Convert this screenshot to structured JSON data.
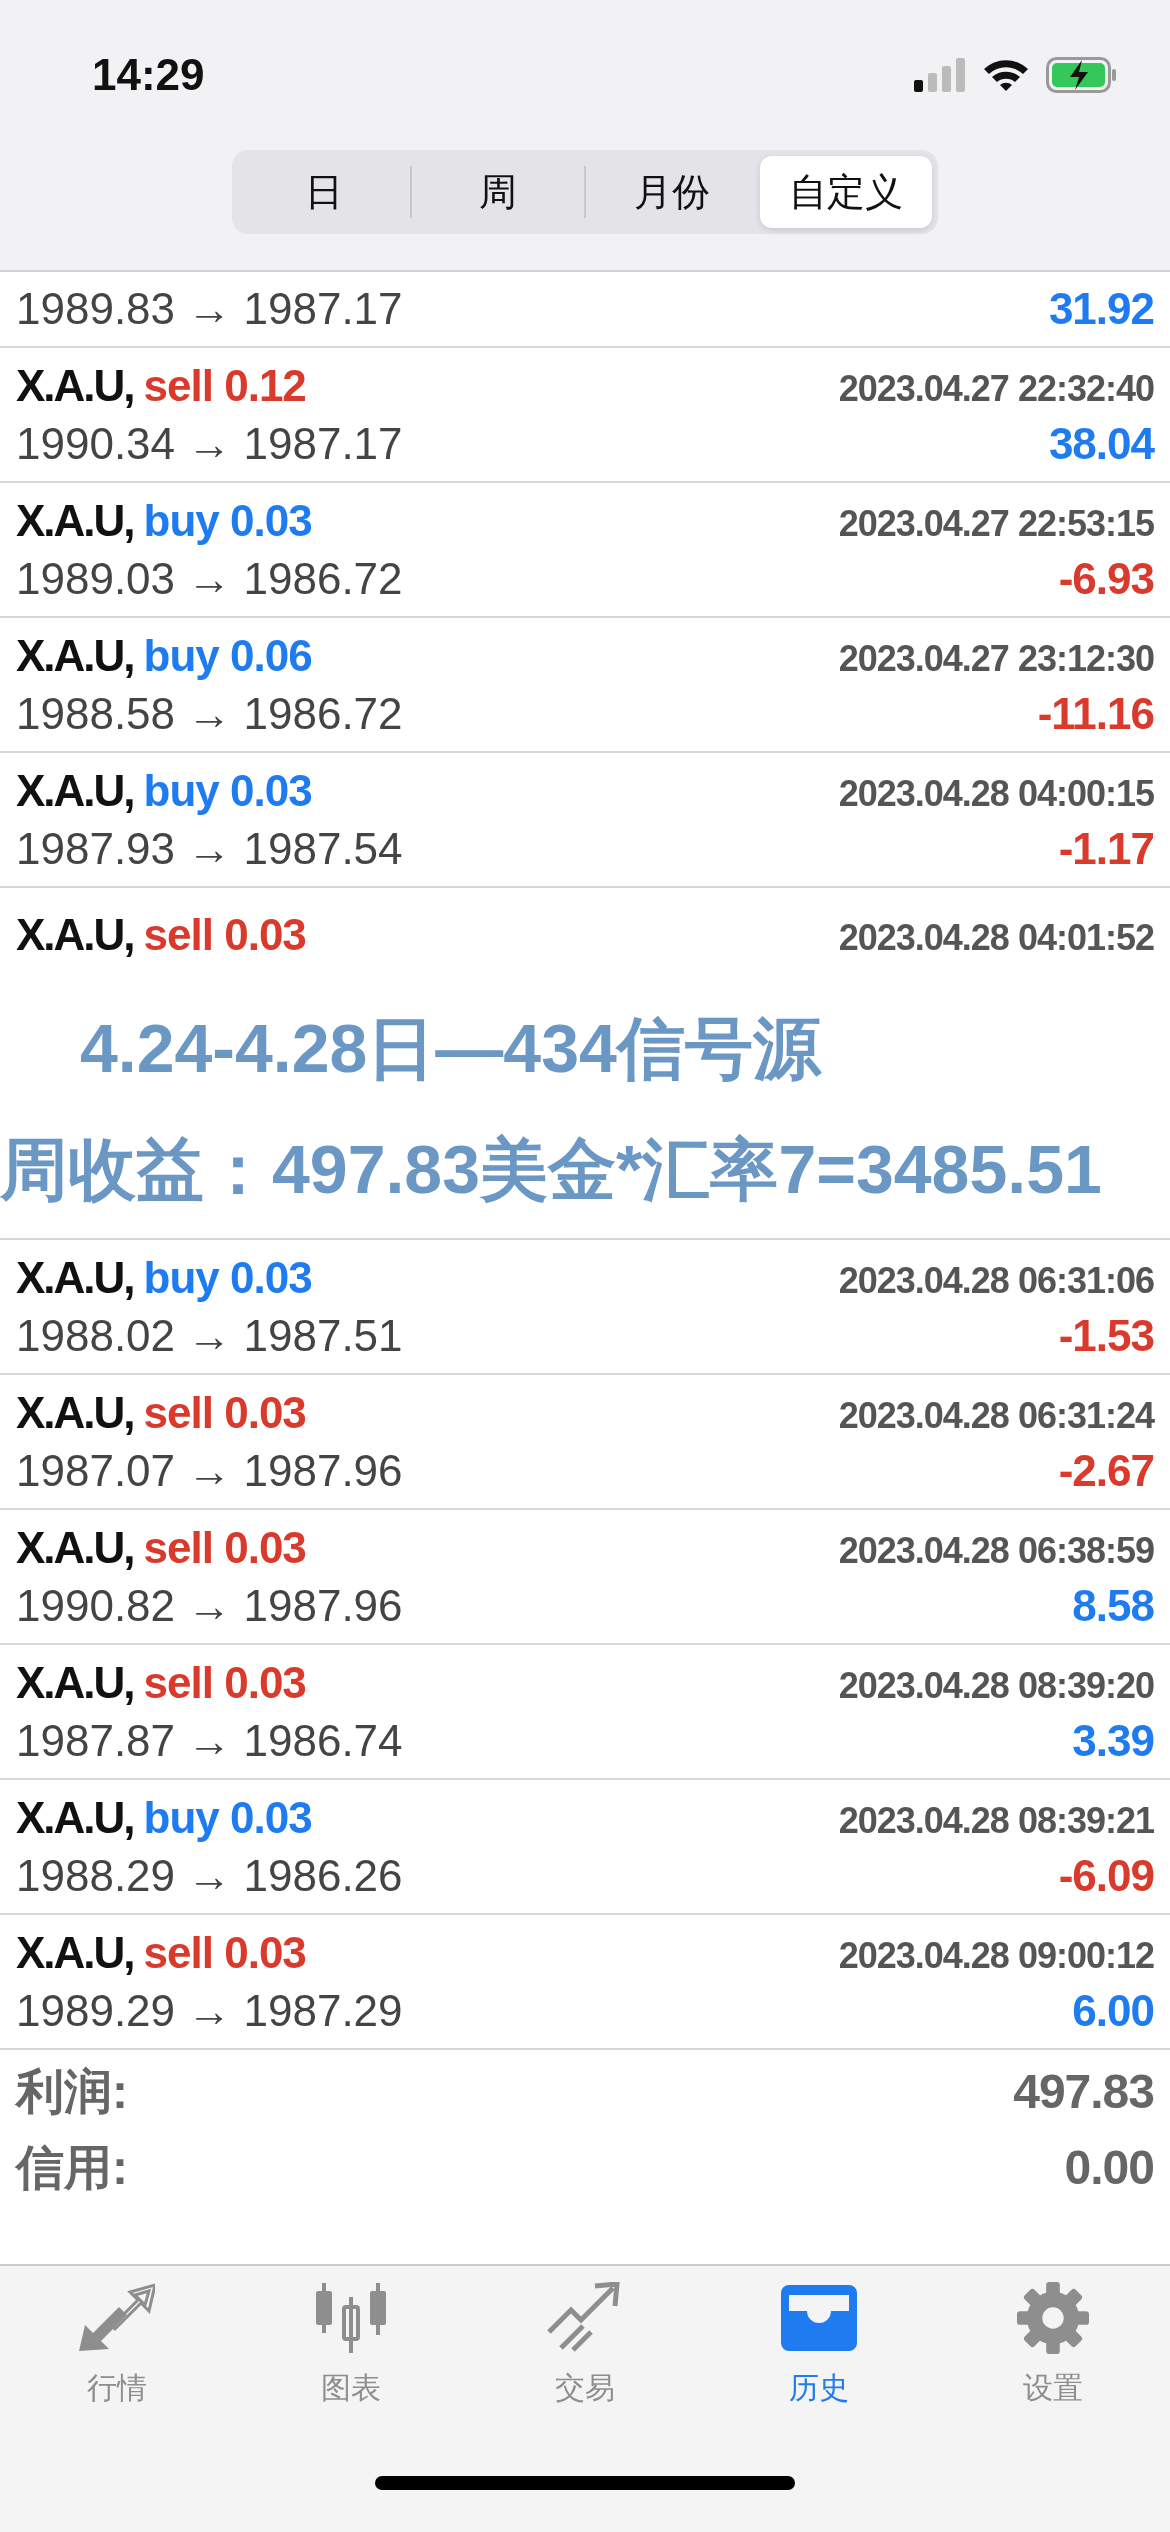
{
  "status_bar": {
    "time": "14:29"
  },
  "segments": [
    {
      "label": "日",
      "selected": false
    },
    {
      "label": "周",
      "selected": false
    },
    {
      "label": "月份",
      "selected": false
    },
    {
      "label": "自定义",
      "selected": true
    }
  ],
  "deals_top": [
    {
      "kind": "prices_only",
      "prices": "1989.83 → 1987.17",
      "profit": {
        "text": "31.92",
        "color": "#1f7cf0"
      }
    },
    {
      "kind": "full",
      "symbol": "X.A.U,",
      "volume": {
        "text": "sell 0.12",
        "color": "#d93a2b"
      },
      "time": "2023.04.27 22:32:40",
      "prices": "1990.34 → 1987.17",
      "profit": {
        "text": "38.04",
        "color": "#1f7cf0"
      }
    },
    {
      "kind": "full",
      "symbol": "X.A.U,",
      "volume": {
        "text": "buy 0.03",
        "color": "#1f7cf0"
      },
      "time": "2023.04.27 22:53:15",
      "prices": "1989.03 → 1986.72",
      "profit": {
        "text": "-6.93",
        "color": "#d93a2b"
      }
    },
    {
      "kind": "full",
      "symbol": "X.A.U,",
      "volume": {
        "text": "buy 0.06",
        "color": "#1f7cf0"
      },
      "time": "2023.04.27 23:12:30",
      "prices": "1988.58 → 1986.72",
      "profit": {
        "text": "-11.16",
        "color": "#d93a2b"
      }
    },
    {
      "kind": "full",
      "symbol": "X.A.U,",
      "volume": {
        "text": "buy 0.03",
        "color": "#1f7cf0"
      },
      "time": "2023.04.28 04:00:15",
      "prices": "1987.93 → 1987.54",
      "profit": {
        "text": "-1.17",
        "color": "#d93a2b"
      }
    },
    {
      "kind": "header_only",
      "symbol": "X.A.U,",
      "volume": {
        "text": "sell 0.03",
        "color": "#d93a2b"
      },
      "time": "2023.04.28 04:01:52"
    }
  ],
  "banner": {
    "line_1": "4.24-4.28日—434信号源",
    "line_2": "周收益：497.83美金*汇率7=3485.51"
  },
  "deals_bottom": [
    {
      "kind": "full",
      "symbol": "X.A.U,",
      "volume": {
        "text": "buy 0.03",
        "color": "#1f7cf0"
      },
      "time": "2023.04.28 06:31:06",
      "prices": "1988.02 → 1987.51",
      "profit": {
        "text": "-1.53",
        "color": "#d93a2b"
      }
    },
    {
      "kind": "full",
      "symbol": "X.A.U,",
      "volume": {
        "text": "sell 0.03",
        "color": "#d93a2b"
      },
      "time": "2023.04.28 06:31:24",
      "prices": "1987.07 → 1987.96",
      "profit": {
        "text": "-2.67",
        "color": "#d93a2b"
      }
    },
    {
      "kind": "full",
      "symbol": "X.A.U,",
      "volume": {
        "text": "sell 0.03",
        "color": "#d93a2b"
      },
      "time": "2023.04.28 06:38:59",
      "prices": "1990.82 → 1987.96",
      "profit": {
        "text": "8.58",
        "color": "#1f7cf0"
      }
    },
    {
      "kind": "full",
      "symbol": "X.A.U,",
      "volume": {
        "text": "sell 0.03",
        "color": "#d93a2b"
      },
      "time": "2023.04.28 08:39:20",
      "prices": "1987.87 → 1986.74",
      "profit": {
        "text": "3.39",
        "color": "#1f7cf0"
      }
    },
    {
      "kind": "full",
      "symbol": "X.A.U,",
      "volume": {
        "text": "buy 0.03",
        "color": "#1f7cf0"
      },
      "time": "2023.04.28 08:39:21",
      "prices": "1988.29 → 1986.26",
      "profit": {
        "text": "-6.09",
        "color": "#d93a2b"
      }
    },
    {
      "kind": "full",
      "symbol": "X.A.U,",
      "volume": {
        "text": "sell 0.03",
        "color": "#d93a2b"
      },
      "time": "2023.04.28 09:00:12",
      "prices": "1989.29 → 1987.29",
      "profit": {
        "text": "6.00",
        "color": "#1f7cf0"
      }
    }
  ],
  "summary": [
    {
      "label": "利润:",
      "value": "497.83"
    },
    {
      "label": "信用:",
      "value": "0.00"
    }
  ],
  "tab_bar": [
    {
      "kind": "quotes",
      "label": "行情",
      "selected": false
    },
    {
      "kind": "chart",
      "label": "图表",
      "selected": false
    },
    {
      "kind": "trade",
      "label": "交易",
      "selected": false
    },
    {
      "kind": "history",
      "label": "历史",
      "selected": true
    },
    {
      "kind": "settings",
      "label": "设置",
      "selected": false
    }
  ]
}
